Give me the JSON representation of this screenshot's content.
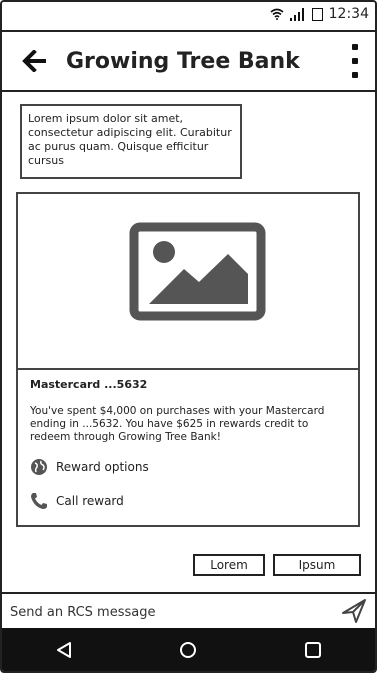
{
  "status_bar": {
    "time": "12:34"
  },
  "app_bar": {
    "title": "Growing Tree Bank"
  },
  "message": {
    "text": "Lorem ipsum dolor sit amet, consectetur adipiscing elit. Curabitur ac purus quam. Quisque efficitur cursus"
  },
  "card": {
    "title": "Mastercard ...5632",
    "body": "You've spent $4,000 on purchases with your Mastercard ending in ...5632. You have $625 in rewards credit to redeem through Growing Tree Bank!",
    "actions": [
      {
        "label": "Reward options",
        "icon": "globe-icon"
      },
      {
        "label": "Call reward",
        "icon": "phone-icon"
      }
    ]
  },
  "suggestions": [
    "Lorem",
    "Ipsum"
  ],
  "composer": {
    "placeholder": "Send an RCS message"
  },
  "colors": {
    "nav_background": "#111111",
    "image_gray": "#555555"
  }
}
